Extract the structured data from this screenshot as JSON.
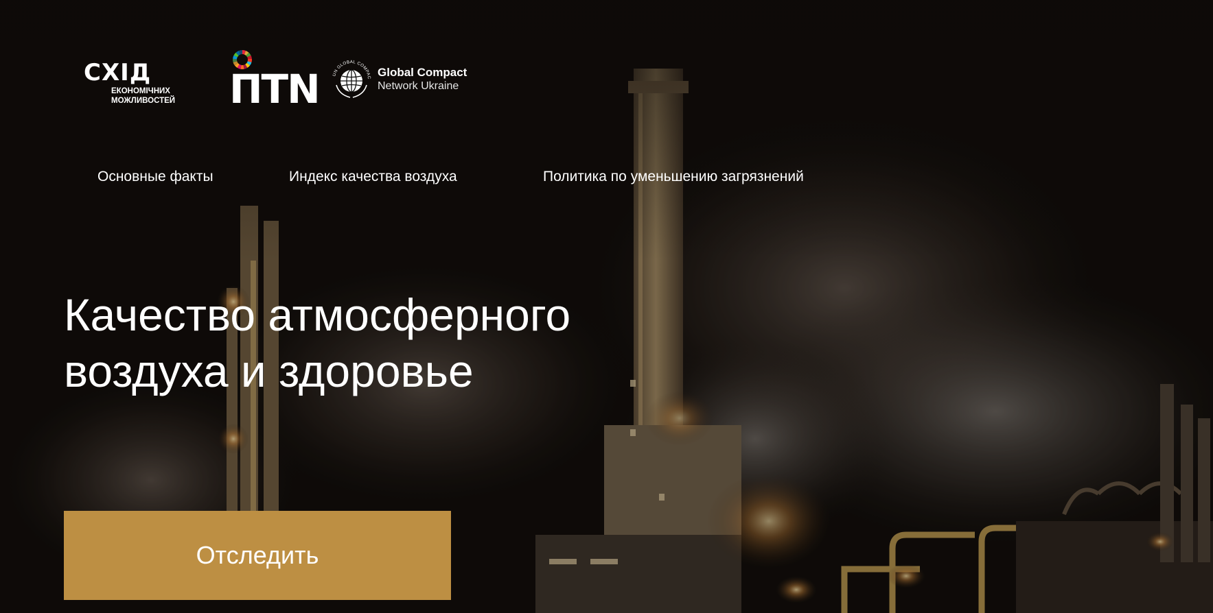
{
  "logos": {
    "skhid": {
      "mark": "СХІД",
      "subtitle": "ЕКОНОМІЧНИХ МОЖЛИВОСТЕЙ"
    },
    "ptn": {
      "text": "ПТN"
    },
    "global_compact": {
      "line1": "Global Compact",
      "line2": "Network Ukraine",
      "ring_text": "UN GLOBAL COMPACT"
    }
  },
  "nav": {
    "items": [
      {
        "label": "Основные факты"
      },
      {
        "label": "Индекс качества воздуха"
      },
      {
        "label": "Политика по уменьшению загрязнений"
      }
    ]
  },
  "hero": {
    "title_line1": "Качество атмосферного",
    "title_line2": "воздуха и здоровье",
    "cta_label": "Отследить"
  },
  "colors": {
    "background": "#0f0c0a",
    "accent": "#bd8f43",
    "text": "#ffffff",
    "sdg_ring": [
      "#e5243b",
      "#dda63a",
      "#4c9f38",
      "#c5192d",
      "#ff3a21",
      "#26bde2",
      "#fcc30b",
      "#a21942",
      "#fd6925",
      "#dd1367",
      "#fd9d24",
      "#bf8b2e",
      "#3f7e44",
      "#0a97d9",
      "#56c02b",
      "#00689d",
      "#19486a"
    ]
  }
}
